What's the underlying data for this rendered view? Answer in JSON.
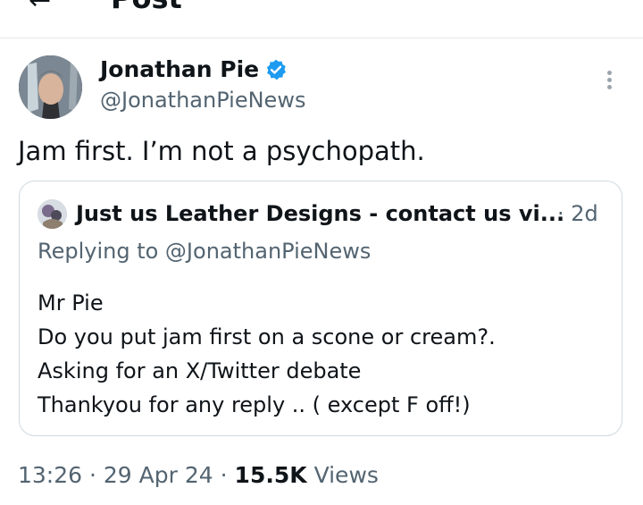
{
  "header": {
    "title": "Post",
    "back_icon": "back-arrow-icon"
  },
  "author": {
    "name": "Jonathan Pie",
    "handle": "@JonathanPieNews",
    "verified": true,
    "verified_color": "#1d9bf0"
  },
  "post": {
    "text": "Jam first. I’m not a psychopath."
  },
  "quote": {
    "name": "Just us Leather Designs - contact us vi...",
    "time": "· 2d",
    "replying_to": "Replying to @JonathanPieNews",
    "lines": [
      "Mr Pie",
      "Do you put jam first on a scone or cream?.",
      "Asking for an X/Twitter debate",
      "Thankyou for any reply .. ( except F off!)"
    ]
  },
  "meta": {
    "time": "13:26",
    "date": "29 Apr 24",
    "views_count": "15.5K",
    "views_label": "Views",
    "separator": "·"
  }
}
